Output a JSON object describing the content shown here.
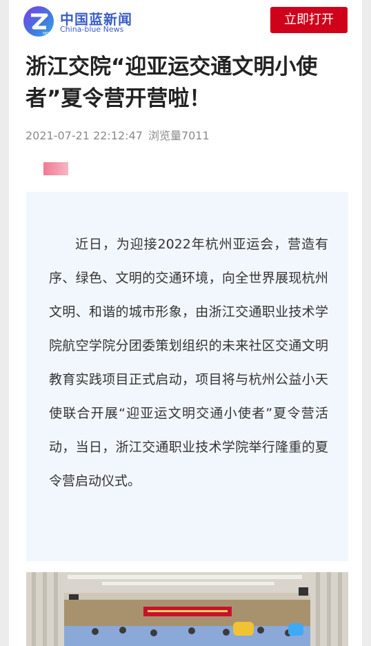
{
  "header": {
    "logo_cn": "中国蓝新闻",
    "logo_en": "China-blue News",
    "logo_badge": "NEWS",
    "open_button": "立即打开"
  },
  "article": {
    "title": "浙江交院“迎亚运交通文明小使者”夏令营开营啦！",
    "date": "2021-07-21 22:12:47",
    "views": "浏览量7011",
    "body": "近日，为迎接2022年杭州亚运会，营造有序、绿色、文明的交通环境，向全世界展现杭州文明、和谐的城市形象，由浙江交通职业技术学院航空学院分团委策划组织的未来社区交通文明教育实践项目正式启动，项目将与杭州公益小天使联合开展“迎亚运文明交通小使者”夏令营活动，当日，浙江交通职业技术学院举行隆重的夏令营启动仪式。"
  },
  "icons": {
    "logo": "china-blue-z-logo"
  },
  "colors": {
    "brand_blue": "#3a5dc8",
    "open_button_red": "#d0021b",
    "content_background": "#f2f7fd"
  }
}
